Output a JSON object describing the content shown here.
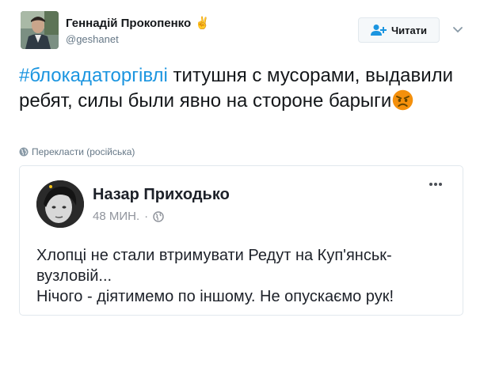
{
  "tweet": {
    "author": {
      "name": "Геннадій Прокопенко",
      "name_emoji": "✌",
      "handle": "@geshanet"
    },
    "follow_button": {
      "label": "Читати",
      "icon": "add-user-icon"
    },
    "menu_icon": "chevron-down-icon",
    "text": {
      "hashtag": "#блокадаторгівлі",
      "body": " титушня с мусорами, выдавили ребят, силы были явно на стороне барыги",
      "emoji": "angry-face-emoji"
    },
    "translate": {
      "label": "Перекласти (російська)",
      "icon": "globe-icon"
    }
  },
  "embedded_post": {
    "author": "Назар Приходько",
    "time": "48 МИН.",
    "separator": "·",
    "privacy_icon": "globe-icon",
    "more_icon": "more-dots-icon",
    "lines": [
      "Хлопці не стали втримувати Редут на Куп'янськ-вузловій...",
      "Нічого - діятимемо по іншому. Не опускаємо рук!"
    ]
  },
  "colors": {
    "hashtag": "#1b95e0",
    "text": "#14171a",
    "secondary": "#657786",
    "card_border": "#e1e8ed",
    "fb_text": "#1d2129",
    "fb_meta": "#90949c"
  }
}
